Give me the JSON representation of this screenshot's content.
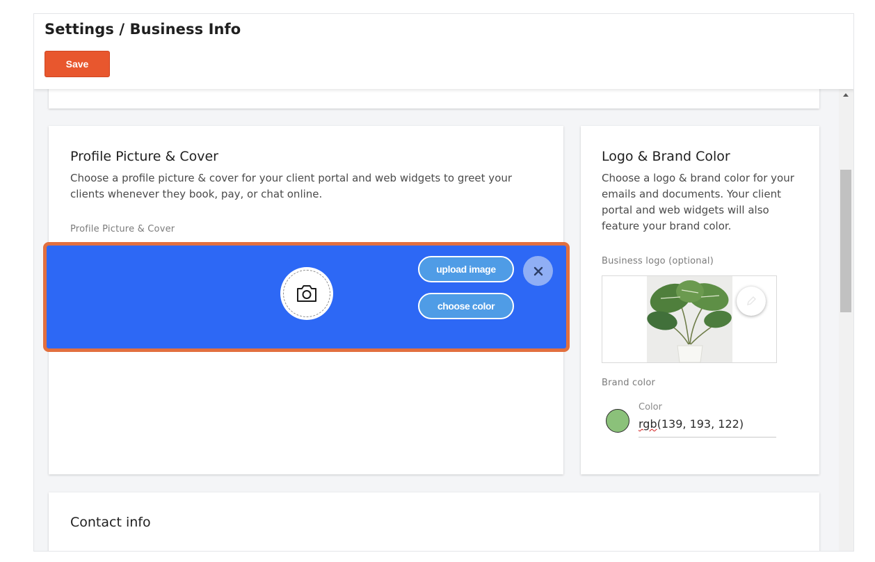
{
  "header": {
    "title": "Settings / Business Info",
    "save_label": "Save"
  },
  "profile_card": {
    "title": "Profile Picture & Cover",
    "description": "Choose a profile picture & cover for your client portal and web widgets to greet your clients whenever they book, pay, or chat online.",
    "field_label": "Profile Picture & Cover",
    "cover_color": "#2d68f5",
    "upload_label": "upload image",
    "choose_color_label": "choose color",
    "camera_icon": "camera-icon",
    "close_icon": "close-icon"
  },
  "logo_card": {
    "title": "Logo & Brand Color",
    "description": "Choose a logo & brand color for your emails and documents. Your client portal and web widgets will also feature your brand color.",
    "logo_label": "Business logo (optional)",
    "brand_color_label": "Brand color",
    "color_field_label": "Color",
    "color_value_prefix": "rgb",
    "color_value_rest": "(139, 193, 122)",
    "brand_color": "#8bc17a",
    "edit_icon": "pencil-icon"
  },
  "contact_card": {
    "title": "Contact info"
  },
  "colors": {
    "accent_save": "#e8572e",
    "highlight_border": "#e2703f",
    "pill_blue": "#4f9ce6"
  }
}
